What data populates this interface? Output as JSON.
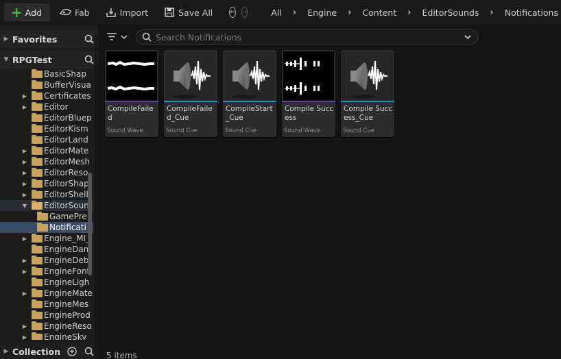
{
  "toolbar": {
    "add_label": "Add",
    "fab_label": "Fab",
    "import_label": "Import",
    "save_all_label": "Save All"
  },
  "breadcrumbs": [
    "All",
    "Engine",
    "Content",
    "EditorSounds",
    "Notifications"
  ],
  "sidebar": {
    "favorites_label": "Favorites",
    "project_label": "RPGTest",
    "collection_label": "Collection",
    "tree": [
      {
        "label": "BasicShap",
        "indent": 1,
        "expandable": false,
        "state": ""
      },
      {
        "label": "BufferVisua",
        "indent": 1,
        "expandable": false,
        "state": ""
      },
      {
        "label": "Certificates",
        "indent": 1,
        "expandable": true,
        "state": ""
      },
      {
        "label": "Editor",
        "indent": 1,
        "expandable": true,
        "state": ""
      },
      {
        "label": "EditorBluep",
        "indent": 1,
        "expandable": false,
        "state": ""
      },
      {
        "label": "EditorKism",
        "indent": 1,
        "expandable": false,
        "state": ""
      },
      {
        "label": "EditorLand",
        "indent": 1,
        "expandable": false,
        "state": ""
      },
      {
        "label": "EditorMate",
        "indent": 1,
        "expandable": true,
        "state": ""
      },
      {
        "label": "EditorMesh",
        "indent": 1,
        "expandable": true,
        "state": ""
      },
      {
        "label": "EditorReso",
        "indent": 1,
        "expandable": true,
        "state": ""
      },
      {
        "label": "EditorShap",
        "indent": 1,
        "expandable": true,
        "state": ""
      },
      {
        "label": "EditorShell",
        "indent": 1,
        "expandable": true,
        "state": ""
      },
      {
        "label": "EditorSoun",
        "indent": 1,
        "expandable": true,
        "state": "open"
      },
      {
        "label": "GamePre",
        "indent": 2,
        "expandable": false,
        "state": ""
      },
      {
        "label": "Notificati",
        "indent": 2,
        "expandable": false,
        "state": "selected"
      },
      {
        "label": "Engine_MI_",
        "indent": 1,
        "expandable": true,
        "state": ""
      },
      {
        "label": "EngineDam",
        "indent": 1,
        "expandable": false,
        "state": ""
      },
      {
        "label": "EngineDeb",
        "indent": 1,
        "expandable": true,
        "state": ""
      },
      {
        "label": "EngineFont",
        "indent": 1,
        "expandable": true,
        "state": ""
      },
      {
        "label": "EngineLigh",
        "indent": 1,
        "expandable": false,
        "state": ""
      },
      {
        "label": "EngineMate",
        "indent": 1,
        "expandable": true,
        "state": ""
      },
      {
        "label": "EngineMes",
        "indent": 1,
        "expandable": false,
        "state": ""
      },
      {
        "label": "EngineProd",
        "indent": 1,
        "expandable": false,
        "state": ""
      },
      {
        "label": "EngineReso",
        "indent": 1,
        "expandable": true,
        "state": ""
      },
      {
        "label": "EngineSky",
        "indent": 1,
        "expandable": true,
        "state": ""
      }
    ]
  },
  "search": {
    "placeholder": "Search Notifications"
  },
  "assets": [
    {
      "name": "CompileFailed",
      "type": "Sound Wave",
      "kind": "wave",
      "thumb": "wave-a"
    },
    {
      "name": "CompileFailed_Cue",
      "type": "Sound Cue",
      "kind": "cue",
      "thumb": "speaker"
    },
    {
      "name": "CompileStart_Cue",
      "type": "Sound Cue",
      "kind": "cue",
      "thumb": "speaker"
    },
    {
      "name": "Compile Success",
      "type": "Sound Wave",
      "kind": "wave",
      "thumb": "wave-b"
    },
    {
      "name": "Compile Success_Cue",
      "type": "Sound Cue",
      "kind": "cue",
      "thumb": "speaker"
    }
  ],
  "status": {
    "item_count": "5 items"
  },
  "colors": {
    "accent_add": "#3fbf3f",
    "sound_wave_bar": "#6a3fa8",
    "sound_cue_bar": "#1e93cf",
    "folder": "#c8a15c",
    "selection": "#3b4d66"
  }
}
